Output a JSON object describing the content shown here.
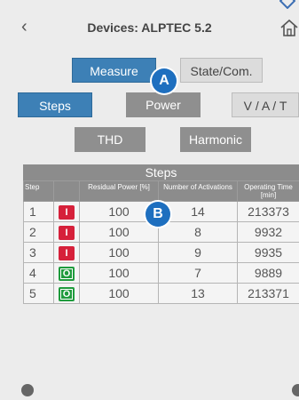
{
  "header": {
    "title": "Devices: ALPTEC 5.2",
    "back_icon": "chevron-left-icon",
    "home_icon": "home-icon"
  },
  "tabs_row1": {
    "measure": "Measure",
    "state": "State/Com."
  },
  "tabs_row2": {
    "steps": "Steps",
    "power": "Power",
    "vat": "V / A / T"
  },
  "tabs_row3": {
    "thd": "THD",
    "harmonic": "Harmonic"
  },
  "markers": {
    "a": "A",
    "b": "B"
  },
  "table": {
    "title": "Steps",
    "headers": [
      "Step",
      "",
      "Residual Power [%]",
      "Number of Activations",
      "Operating Time [min]"
    ],
    "rows": [
      {
        "step": "1",
        "state": "I",
        "power": "100",
        "activations": "14",
        "time": "213373"
      },
      {
        "step": "2",
        "state": "I",
        "power": "100",
        "activations": "8",
        "time": "9932"
      },
      {
        "step": "3",
        "state": "I",
        "power": "100",
        "activations": "9",
        "time": "9935"
      },
      {
        "step": "4",
        "state": "O",
        "power": "100",
        "activations": "7",
        "time": "9889"
      },
      {
        "step": "5",
        "state": "O",
        "power": "100",
        "activations": "13",
        "time": "213371"
      }
    ]
  },
  "colors": {
    "active": "#3d80b6",
    "marker": "#1e6fbf",
    "state_on": "#d6203a",
    "state_off": "#1f9b3d"
  }
}
